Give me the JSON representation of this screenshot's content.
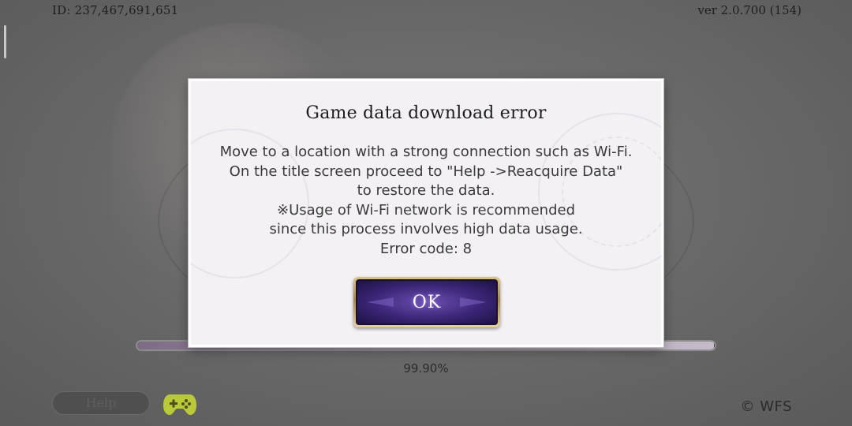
{
  "header": {
    "user_id": "ID: 237,467,691,651",
    "version": "ver 2.0.700 (154)"
  },
  "dialog": {
    "title": "Game data download error",
    "lines": [
      "Move to a location with a strong connection such as Wi-Fi.",
      "On the title screen proceed to \"Help ->Reacquire Data\"",
      "to restore the data.",
      "※Usage of Wi-Fi network is recommended",
      "since this process involves high data usage.",
      "Error code: 8"
    ],
    "ok_label": "OK"
  },
  "progress": {
    "value": 0.999,
    "text": "99.90%"
  },
  "footer": {
    "help_label": "Help",
    "gamepad_icon": "gamepad-icon",
    "copyright": "© WFS"
  },
  "colors": {
    "dialog_bg": "#f4f1f5",
    "button_purple": "#3b2677",
    "button_gold": "#a98a3e",
    "gamepad_green": "#b9c93a"
  }
}
